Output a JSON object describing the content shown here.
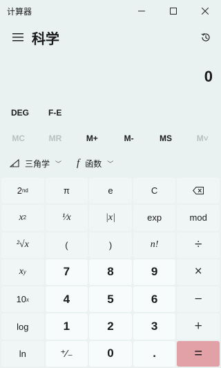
{
  "window": {
    "title": "计算器"
  },
  "header": {
    "mode": "科学"
  },
  "display": {
    "value": "0"
  },
  "angle": {
    "unit": "DEG",
    "notation": "F-E"
  },
  "memory": [
    "MC",
    "MR",
    "M+",
    "M-",
    "MS",
    "M˅"
  ],
  "functions": {
    "trig": "三角学",
    "func_icon": "f",
    "func": "函数"
  },
  "keys": {
    "second": "2",
    "second_sup": "nd",
    "pi": "π",
    "e": "e",
    "clear": "C",
    "x2_base": "x",
    "x2_sup": "2",
    "recip": "¹⁄x",
    "abs": "|x|",
    "exp": "exp",
    "mod": "mod",
    "sqrt": "²√x",
    "lparen": "(",
    "rparen": ")",
    "fact": "n!",
    "div": "÷",
    "xy_base": "x",
    "xy_sup": "y",
    "n7": "7",
    "n8": "8",
    "n9": "9",
    "mul": "×",
    "tenx_base": "10",
    "tenx_sup": "x",
    "n4": "4",
    "n5": "5",
    "n6": "6",
    "minus": "−",
    "log": "log",
    "n1": "1",
    "n2": "2",
    "n3": "3",
    "plus": "+",
    "ln": "ln",
    "negate": "⁺⁄₋",
    "n0": "0",
    "dot": ".",
    "equals": "="
  }
}
